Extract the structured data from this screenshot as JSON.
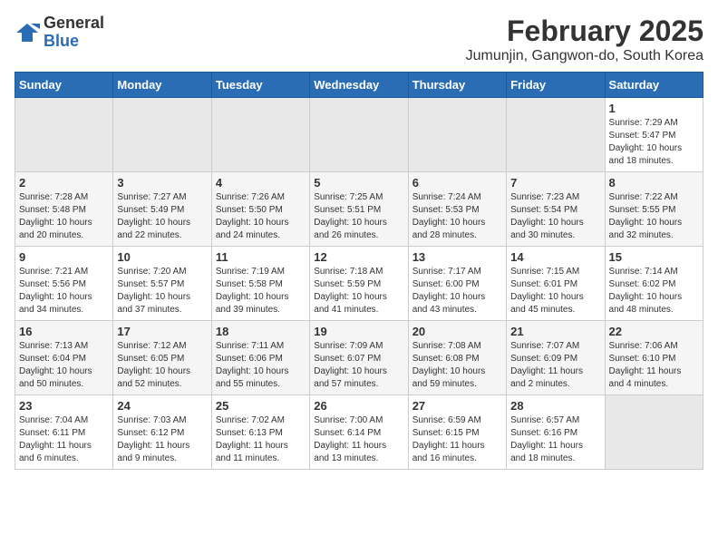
{
  "logo": {
    "general": "General",
    "blue": "Blue"
  },
  "title": "February 2025",
  "subtitle": "Jumunjin, Gangwon-do, South Korea",
  "weekdays": [
    "Sunday",
    "Monday",
    "Tuesday",
    "Wednesday",
    "Thursday",
    "Friday",
    "Saturday"
  ],
  "weeks": [
    [
      {
        "day": "",
        "info": ""
      },
      {
        "day": "",
        "info": ""
      },
      {
        "day": "",
        "info": ""
      },
      {
        "day": "",
        "info": ""
      },
      {
        "day": "",
        "info": ""
      },
      {
        "day": "",
        "info": ""
      },
      {
        "day": "1",
        "info": "Sunrise: 7:29 AM\nSunset: 5:47 PM\nDaylight: 10 hours\nand 18 minutes."
      }
    ],
    [
      {
        "day": "2",
        "info": "Sunrise: 7:28 AM\nSunset: 5:48 PM\nDaylight: 10 hours\nand 20 minutes."
      },
      {
        "day": "3",
        "info": "Sunrise: 7:27 AM\nSunset: 5:49 PM\nDaylight: 10 hours\nand 22 minutes."
      },
      {
        "day": "4",
        "info": "Sunrise: 7:26 AM\nSunset: 5:50 PM\nDaylight: 10 hours\nand 24 minutes."
      },
      {
        "day": "5",
        "info": "Sunrise: 7:25 AM\nSunset: 5:51 PM\nDaylight: 10 hours\nand 26 minutes."
      },
      {
        "day": "6",
        "info": "Sunrise: 7:24 AM\nSunset: 5:53 PM\nDaylight: 10 hours\nand 28 minutes."
      },
      {
        "day": "7",
        "info": "Sunrise: 7:23 AM\nSunset: 5:54 PM\nDaylight: 10 hours\nand 30 minutes."
      },
      {
        "day": "8",
        "info": "Sunrise: 7:22 AM\nSunset: 5:55 PM\nDaylight: 10 hours\nand 32 minutes."
      }
    ],
    [
      {
        "day": "9",
        "info": "Sunrise: 7:21 AM\nSunset: 5:56 PM\nDaylight: 10 hours\nand 34 minutes."
      },
      {
        "day": "10",
        "info": "Sunrise: 7:20 AM\nSunset: 5:57 PM\nDaylight: 10 hours\nand 37 minutes."
      },
      {
        "day": "11",
        "info": "Sunrise: 7:19 AM\nSunset: 5:58 PM\nDaylight: 10 hours\nand 39 minutes."
      },
      {
        "day": "12",
        "info": "Sunrise: 7:18 AM\nSunset: 5:59 PM\nDaylight: 10 hours\nand 41 minutes."
      },
      {
        "day": "13",
        "info": "Sunrise: 7:17 AM\nSunset: 6:00 PM\nDaylight: 10 hours\nand 43 minutes."
      },
      {
        "day": "14",
        "info": "Sunrise: 7:15 AM\nSunset: 6:01 PM\nDaylight: 10 hours\nand 45 minutes."
      },
      {
        "day": "15",
        "info": "Sunrise: 7:14 AM\nSunset: 6:02 PM\nDaylight: 10 hours\nand 48 minutes."
      }
    ],
    [
      {
        "day": "16",
        "info": "Sunrise: 7:13 AM\nSunset: 6:04 PM\nDaylight: 10 hours\nand 50 minutes."
      },
      {
        "day": "17",
        "info": "Sunrise: 7:12 AM\nSunset: 6:05 PM\nDaylight: 10 hours\nand 52 minutes."
      },
      {
        "day": "18",
        "info": "Sunrise: 7:11 AM\nSunset: 6:06 PM\nDaylight: 10 hours\nand 55 minutes."
      },
      {
        "day": "19",
        "info": "Sunrise: 7:09 AM\nSunset: 6:07 PM\nDaylight: 10 hours\nand 57 minutes."
      },
      {
        "day": "20",
        "info": "Sunrise: 7:08 AM\nSunset: 6:08 PM\nDaylight: 10 hours\nand 59 minutes."
      },
      {
        "day": "21",
        "info": "Sunrise: 7:07 AM\nSunset: 6:09 PM\nDaylight: 11 hours\nand 2 minutes."
      },
      {
        "day": "22",
        "info": "Sunrise: 7:06 AM\nSunset: 6:10 PM\nDaylight: 11 hours\nand 4 minutes."
      }
    ],
    [
      {
        "day": "23",
        "info": "Sunrise: 7:04 AM\nSunset: 6:11 PM\nDaylight: 11 hours\nand 6 minutes."
      },
      {
        "day": "24",
        "info": "Sunrise: 7:03 AM\nSunset: 6:12 PM\nDaylight: 11 hours\nand 9 minutes."
      },
      {
        "day": "25",
        "info": "Sunrise: 7:02 AM\nSunset: 6:13 PM\nDaylight: 11 hours\nand 11 minutes."
      },
      {
        "day": "26",
        "info": "Sunrise: 7:00 AM\nSunset: 6:14 PM\nDaylight: 11 hours\nand 13 minutes."
      },
      {
        "day": "27",
        "info": "Sunrise: 6:59 AM\nSunset: 6:15 PM\nDaylight: 11 hours\nand 16 minutes."
      },
      {
        "day": "28",
        "info": "Sunrise: 6:57 AM\nSunset: 6:16 PM\nDaylight: 11 hours\nand 18 minutes."
      },
      {
        "day": "",
        "info": ""
      }
    ]
  ]
}
